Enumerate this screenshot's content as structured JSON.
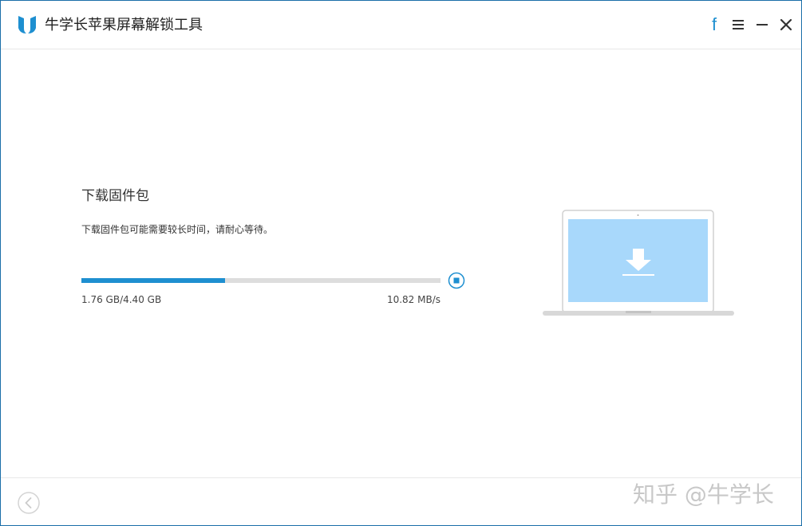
{
  "window": {
    "title": "牛学长苹果屏幕解锁工具"
  },
  "titlebar": {
    "facebook_label": "f",
    "icons": [
      "app-logo-icon",
      "facebook-icon",
      "menu-icon",
      "minimize-icon",
      "close-icon"
    ]
  },
  "content": {
    "title": "下载固件包",
    "description": "下载固件包可能需要较长时间，请耐心等待。",
    "progress": {
      "downloaded": "1.76 GB/4.40 GB",
      "speed": "10.82 MB/s",
      "fraction": 0.4
    }
  },
  "illustration": {
    "icon": "laptop-download-icon"
  },
  "footer": {
    "back_icon": "back-arrow-icon"
  },
  "watermark": {
    "text": "知乎 @牛学长"
  },
  "colors": {
    "accent": "#1e8fd0",
    "frame": "#1a6ea8",
    "screen": "#a8d8fb",
    "track": "#dddddd"
  }
}
